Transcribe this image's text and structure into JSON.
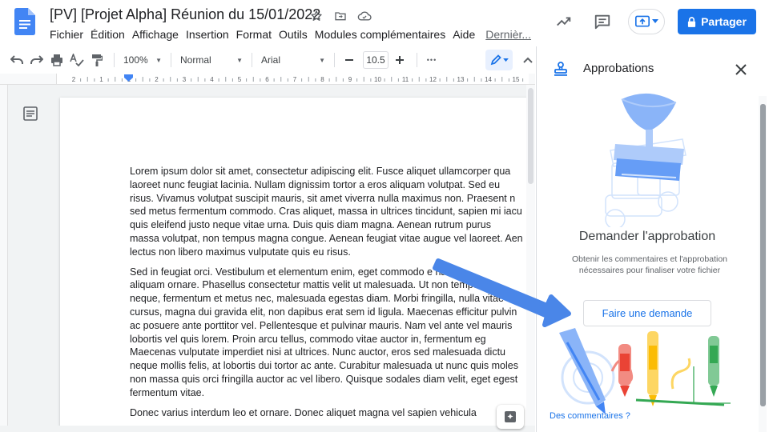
{
  "document": {
    "title": "[PV] [Projet Alpha] Réunion du 15/01/2022"
  },
  "menu": {
    "items": [
      "Fichier",
      "Édition",
      "Affichage",
      "Insertion",
      "Format",
      "Outils",
      "Modules complémentaires",
      "Aide"
    ],
    "last_edit": "Dernièr..."
  },
  "header": {
    "share_label": "Partager"
  },
  "toolbar": {
    "zoom": "100%",
    "style": "Normal",
    "font": "Arial",
    "font_size": "10.5",
    "more": "•••"
  },
  "ruler": {
    "numbers": [
      "2",
      "1",
      "1",
      "2",
      "3",
      "4",
      "5",
      "6",
      "7",
      "8",
      "9",
      "10",
      "11",
      "12",
      "13",
      "14",
      "15"
    ]
  },
  "content": {
    "paragraphs": [
      [
        "Lorem ipsum dolor sit amet, consectetur adipiscing elit. Fusce aliquet ullamcorper qua",
        "laoreet nunc feugiat lacinia. Nullam dignissim tortor a eros aliquam volutpat. Sed eu",
        "risus. Vivamus volutpat suscipit mauris, sit amet viverra nulla maximus non. Praesent n",
        "sed metus fermentum commodo. Cras aliquet, massa in ultrices tincidunt, sapien mi iacu",
        "quis eleifend justo neque vitae urna. Duis quis diam magna. Aenean rutrum purus",
        "massa volutpat, non tempus magna congue. Aenean feugiat vitae augue vel laoreet. Aen",
        "lectus non libero maximus vulputate quis eu risus."
      ],
      [
        "Sed in feugiat orci. Vestibulum et elementum enim, eget commodo e        nas ve",
        "aliquam ornare. Phasellus consectetur mattis velit ut malesuada. Ut non tempo",
        "neque, fermentum et metus nec, malesuada egestas diam. Morbi fringilla, nulla vitae",
        "cursus, magna dui gravida elit, non dapibus erat sem id ligula. Maecenas efficitur pulvin",
        "ac posuere ante porttitor vel. Pellentesque et pulvinar mauris. Nam vel ante vel mauris",
        "lobortis vel quis lorem. Proin arcu tellus, commodo vitae auctor in, fermentum eg",
        "Maecenas vulputate imperdiet nisi at ultrices. Nunc auctor, eros sed malesuada dictu",
        "neque mollis felis, at lobortis dui tortor ac ante. Curabitur malesuada ut nunc quis moles",
        "non massa quis orci fringilla auctor ac vel libero. Quisque sodales diam velit, eget egest",
        "fermentum vitae."
      ],
      [
        "Donec varius interdum leo et ornare. Donec aliquet magna vel sapien vehicula"
      ]
    ]
  },
  "panel": {
    "title": "Approbations",
    "heading": "Demander l'approbation",
    "description": "Obtenir les commentaires et l'approbation nécessaires pour finaliser votre fichier",
    "request_button": "Faire une demande",
    "feedback_link": "Des commentaires ?"
  },
  "colors": {
    "accent": "#1a73e8",
    "arrow": "#4a86e8"
  },
  "icons": [
    "docs-logo-icon",
    "star-icon",
    "move-to-folder-icon",
    "cloud-status-icon",
    "trend-icon",
    "comment-history-icon",
    "present-icon",
    "lock-icon",
    "undo-icon",
    "redo-icon",
    "print-icon",
    "spellcheck-icon",
    "paint-format-icon",
    "minus-icon",
    "plus-icon",
    "pencil-icon",
    "chevron-up-icon",
    "outline-icon",
    "explore-icon",
    "approval-stamp-icon",
    "close-icon"
  ]
}
